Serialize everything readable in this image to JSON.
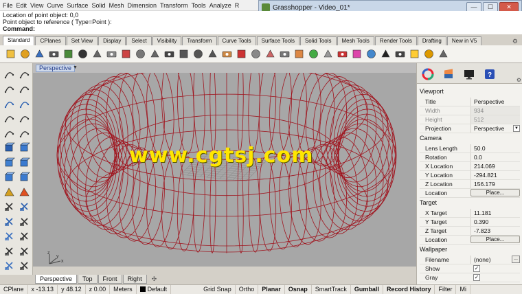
{
  "menu": [
    "File",
    "Edit",
    "View",
    "Curve",
    "Surface",
    "Solid",
    "Mesh",
    "Dimension",
    "Transform",
    "Tools",
    "Analyze",
    "R"
  ],
  "grasshopper": {
    "title": "Grasshopper - Video_01*",
    "min": "—",
    "max": "☐",
    "close": "✕"
  },
  "command": {
    "history": [
      "Location of point object: 0,0",
      "Point object to reference ( Type=Point ):"
    ],
    "prompt": "Command:"
  },
  "tabs": [
    "Standard",
    "CPlanes",
    "Set View",
    "Display",
    "Select",
    "Visibility",
    "Transform",
    "Curve Tools",
    "Surface Tools",
    "Solid Tools",
    "Mesh Tools",
    "Render Tools",
    "Drafting",
    "New in V5"
  ],
  "toolbar_icons": [
    "new-icon",
    "open-icon",
    "save-icon",
    "print-icon",
    "import-icon",
    "cut-icon",
    "copy-icon",
    "paste-icon",
    "undo-icon",
    "pan-icon",
    "rotate-view-icon",
    "zoom-icon",
    "zoom-window-icon",
    "zoom-extents-icon",
    "zoom-selected-icon",
    "four-viewports-icon",
    "car-icon",
    "grid-icon",
    "cplane-icon",
    "point-display-icon",
    "layer-icon",
    "hide-icon",
    "lock-icon",
    "render-icon",
    "color-icon",
    "material-icon",
    "sphere-icon",
    "shaded-icon",
    "light-icon",
    "grasshopper-icon",
    "options-icon"
  ],
  "viewport": {
    "label": "Perspective",
    "watermark": "www.cgtsj.com",
    "bottom_tabs": [
      "Perspective",
      "Top",
      "Front",
      "Right"
    ],
    "add_tab": "✣",
    "axis_y": "y",
    "axis_x": "x",
    "axis_z": "z"
  },
  "status": {
    "cplane": "CPlane",
    "x": "x -13.13",
    "y": "y 48.12",
    "z": "z 0.00",
    "units": "Meters",
    "layer": "Default",
    "toggles": [
      "Grid Snap",
      "Ortho",
      "Planar",
      "Osnap",
      "SmartTrack",
      "Gumball",
      "Record History",
      "Filter"
    ],
    "bold_toggles": [
      "Planar",
      "Osnap",
      "Gumball",
      "Record History"
    ],
    "tail": "Mi"
  },
  "panel": {
    "sections": {
      "viewport": "Viewport",
      "camera": "Camera",
      "target": "Target",
      "wallpaper": "Wallpaper"
    },
    "viewport_rows": [
      {
        "label": "Title",
        "value": "Perspective",
        "dim": false
      },
      {
        "label": "Width",
        "value": "934",
        "dim": true
      },
      {
        "label": "Height",
        "value": "512",
        "dim": true
      },
      {
        "label": "Projection",
        "value": "Perspective",
        "dim": false
      }
    ],
    "camera_rows": [
      {
        "label": "Lens Length",
        "value": "50.0"
      },
      {
        "label": "Rotation",
        "value": "0.0"
      },
      {
        "label": "X Location",
        "value": "214.069"
      },
      {
        "label": "Y Location",
        "value": "-294.821"
      },
      {
        "label": "Z Location",
        "value": "156.179"
      },
      {
        "label": "Location",
        "value": "Place..."
      }
    ],
    "target_rows": [
      {
        "label": "X Target",
        "value": "11.181"
      },
      {
        "label": "Y Target",
        "value": "0.390"
      },
      {
        "label": "Z Target",
        "value": "-7.823"
      },
      {
        "label": "Location",
        "value": "Place..."
      }
    ],
    "wallpaper_rows": [
      {
        "label": "Filename",
        "value": "(none)"
      },
      {
        "label": "Show",
        "value": "✓"
      },
      {
        "label": "Gray",
        "value": "✓"
      }
    ],
    "ellipsis": "...",
    "dropdown": "▼"
  },
  "colors": {
    "wire": "#a0141e",
    "viewport_bg": "#a7a7a7",
    "watermark": "#ffe600"
  }
}
